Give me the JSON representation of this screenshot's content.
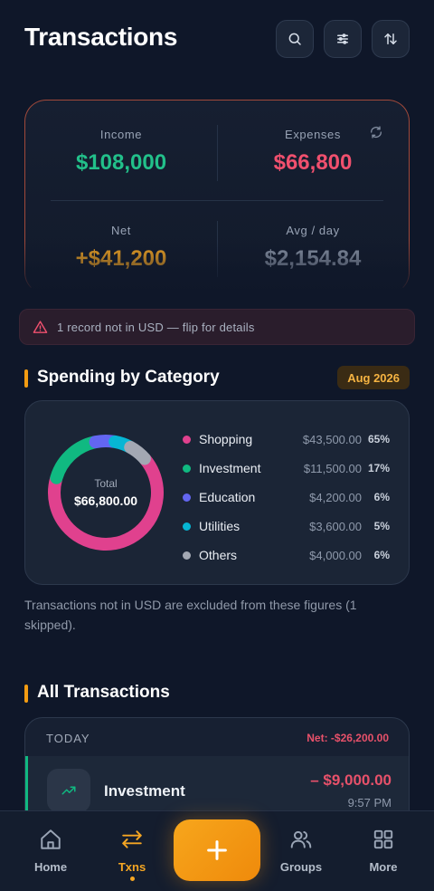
{
  "header": {
    "title": "Transactions",
    "icons": [
      "search-icon",
      "filter-icon",
      "sort-icon"
    ]
  },
  "summary": {
    "income_label": "Income",
    "income_value": "$108,000",
    "expenses_label": "Expenses",
    "expenses_value": "$66,800",
    "net_label": "Net",
    "net_value": "+$41,200",
    "avg_label": "Avg / day",
    "avg_value": "$2,154.84",
    "colors": {
      "income": "#22c08a",
      "expenses": "#f0506e",
      "net": "#f5a623",
      "avg": "#8a94a6"
    }
  },
  "alert": {
    "text": "1 record not in USD — flip for details"
  },
  "spending": {
    "title": "Spending by Category",
    "month": "Aug 2026",
    "total_label": "Total",
    "total_value": "$66,800.00",
    "categories": [
      {
        "name": "Shopping",
        "amount": "$43,500.00",
        "percent": "65%",
        "color": "#e0418e",
        "share": 0.65
      },
      {
        "name": "Investment",
        "amount": "$11,500.00",
        "percent": "17%",
        "color": "#10b981",
        "share": 0.17
      },
      {
        "name": "Education",
        "amount": "$4,200.00",
        "percent": "6%",
        "color": "#6366f1",
        "share": 0.06
      },
      {
        "name": "Utilities",
        "amount": "$3,600.00",
        "percent": "5%",
        "color": "#06b6d4",
        "share": 0.05
      },
      {
        "name": "Others",
        "amount": "$4,000.00",
        "percent": "6%",
        "color": "#a3a8b3",
        "share": 0.06
      }
    ],
    "note": "Transactions not in USD are excluded from these figures (1 skipped)."
  },
  "transactions": {
    "title": "All Transactions",
    "group_label": "TODAY",
    "group_net": "Net: -$26,200.00",
    "items": [
      {
        "name": "Investment",
        "amount": "– $9,000.00",
        "time": "9:57 PM",
        "icon": "trending-up-icon"
      }
    ]
  },
  "nav": {
    "home": "Home",
    "txns": "Txns",
    "groups": "Groups",
    "more": "More",
    "active": "txns"
  }
}
